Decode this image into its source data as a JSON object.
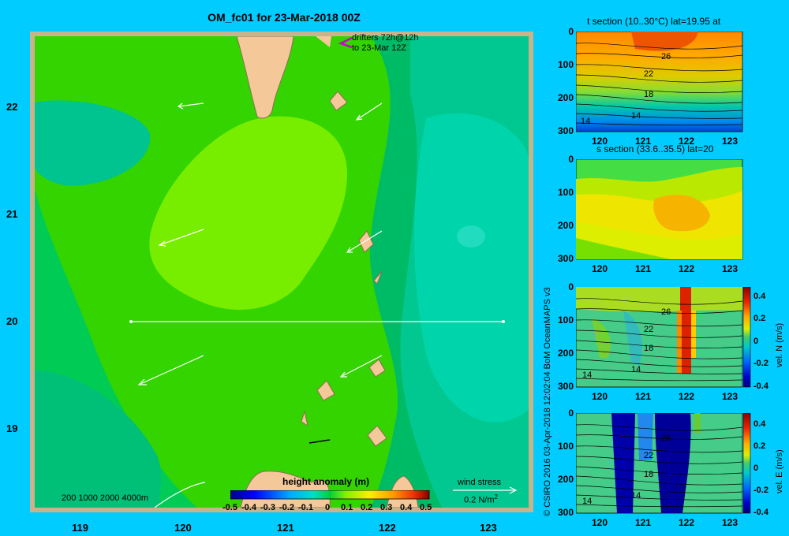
{
  "title": "OM_fc01 for 23-Mar-2018 00Z",
  "map": {
    "lat_ticks": [
      "22",
      "21",
      "20",
      "19"
    ],
    "lon_ticks": [
      "119",
      "120",
      "121",
      "122",
      "123"
    ],
    "drifters_line1": "drifters 72h@12h",
    "drifters_line2": "to 23-Mar 12Z",
    "scale_label": "200  1000  2000  4000m",
    "wind_stress_label": "wind stress",
    "wind_stress_value": "0.2 N/m",
    "wind_stress_exp": "2",
    "colorbar": {
      "title": "height anomaly (m)",
      "ticks": [
        "-0.5",
        "-0.4",
        "-0.3",
        "-0.2",
        "-0.1",
        "0",
        "0.1",
        "0.2",
        "0.3",
        "0.4",
        "0.5"
      ],
      "range": [
        -0.5,
        0.5
      ]
    },
    "section_line": {
      "lon": [
        119.5,
        123.2
      ],
      "lat": 20.0
    },
    "colors": {
      "background": "#00ccff",
      "land": "#f5c89a",
      "frame": "#c8b48c",
      "drifter_marker": "#cc00cc"
    }
  },
  "panels": [
    {
      "title": "t section (10..30°C) lat=19.95 at",
      "x_ticks": [
        "120",
        "121",
        "122",
        "123"
      ],
      "y_ticks": [
        "0",
        "100",
        "200",
        "300"
      ],
      "contour_labels": [
        "26",
        "22",
        "18",
        "14",
        "14"
      ]
    },
    {
      "title": "s section (33.6..35.5) lat=20",
      "x_ticks": [
        "120",
        "121",
        "122",
        "123"
      ],
      "y_ticks": [
        "0",
        "100",
        "200",
        "300"
      ]
    },
    {
      "title": "",
      "x_ticks": [
        "120",
        "121",
        "122",
        "123"
      ],
      "y_ticks": [
        "0",
        "100",
        "200",
        "300"
      ],
      "contour_labels": [
        "26",
        "22",
        "18",
        "14",
        "14"
      ],
      "colorbar_label": "vel. N (m/s)",
      "colorbar_ticks": [
        "0.4",
        "0.2",
        "0",
        "-0.2",
        "-0.4"
      ],
      "colorbar_range": [
        -0.4,
        0.4
      ]
    },
    {
      "title": "",
      "x_ticks": [
        "120",
        "121",
        "122",
        "123"
      ],
      "y_ticks": [
        "0",
        "100",
        "200",
        "300"
      ],
      "contour_labels": [
        "26",
        "22",
        "18",
        "14",
        "14"
      ],
      "colorbar_label": "vel. E (m/s)",
      "colorbar_ticks": [
        "0.4",
        "0.2",
        "0",
        "-0.2",
        "-0.4"
      ],
      "colorbar_range": [
        -0.4,
        0.4
      ]
    }
  ],
  "credit": "© CSIRO 2016   03-Apr-2018 12:02:04 BoM OceanMAPS v3"
}
